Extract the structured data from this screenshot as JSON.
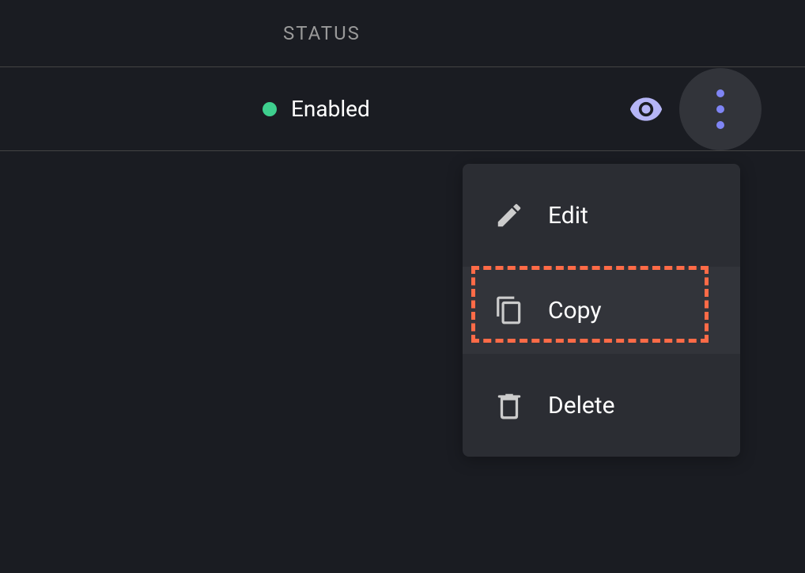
{
  "table": {
    "header": {
      "status": "STATUS"
    },
    "row": {
      "status_text": "Enabled",
      "status_color": "#3ecf8e"
    }
  },
  "dropdown": {
    "items": [
      {
        "label": "Edit",
        "icon": "pencil"
      },
      {
        "label": "Copy",
        "icon": "copy",
        "highlighted": true
      },
      {
        "label": "Delete",
        "icon": "trash"
      }
    ]
  }
}
